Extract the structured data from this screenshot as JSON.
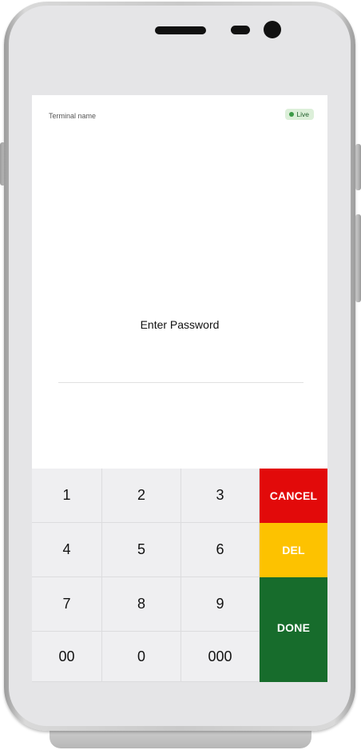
{
  "header": {
    "terminal_name": "Terminal name",
    "status": "Live"
  },
  "main": {
    "prompt": "Enter Password"
  },
  "keypad": {
    "digits": [
      "1",
      "2",
      "3",
      "4",
      "5",
      "6",
      "7",
      "8",
      "9",
      "00",
      "0",
      "000"
    ],
    "cancel_label": "CANCEL",
    "del_label": "DEL",
    "done_label": "DONE"
  },
  "colors": {
    "cancel": "#e20a0a",
    "del": "#fdc200",
    "done": "#176c2c",
    "live_badge": "#dcefd9",
    "live_dot": "#3c9a47"
  }
}
